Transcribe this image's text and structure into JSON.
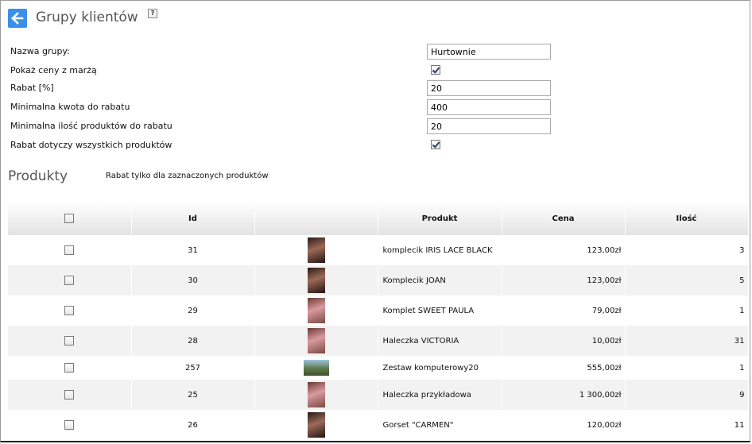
{
  "header": {
    "title": "Grupy klientów",
    "help": "?"
  },
  "form": {
    "group_name_label": "Nazwa grupy:",
    "group_name_value": "Hurtownie",
    "show_prices_label": "Pokaż ceny z marżą",
    "show_prices_checked": true,
    "discount_label": "Rabat [%]",
    "discount_value": "20",
    "min_amount_label": "Minimalna kwota do rabatu",
    "min_amount_value": "400",
    "min_qty_label": "Minimalna ilość produktów do rabatu",
    "min_qty_value": "20",
    "all_products_label": "Rabat dotyczy wszystkich produktów",
    "all_products_checked": true
  },
  "products": {
    "title": "Produkty",
    "note": "Rabat tylko dla zaznaczonych produktów",
    "columns": {
      "id": "Id",
      "image": "",
      "product": "Produkt",
      "price": "Cena",
      "qty": "Ilość"
    },
    "rows": [
      {
        "id": "31",
        "name": "komplecik IRIS LACE BLACK",
        "price": "123,00zł",
        "qty": "3",
        "thumb": "dark"
      },
      {
        "id": "30",
        "name": "Komplecik JOAN",
        "price": "123,00zł",
        "qty": "5",
        "thumb": "dark"
      },
      {
        "id": "29",
        "name": "Komplet SWEET PAULA",
        "price": "79,00zł",
        "qty": "1",
        "thumb": "pink"
      },
      {
        "id": "28",
        "name": "Haleczka VICTORIA",
        "price": "10,00zł",
        "qty": "31",
        "thumb": "pink"
      },
      {
        "id": "257",
        "name": "Zestaw komputerowy20",
        "price": "555,00zł",
        "qty": "1",
        "thumb": "wide"
      },
      {
        "id": "25",
        "name": "Haleczka przykładowa",
        "price": "1 300,00zł",
        "qty": "9",
        "thumb": "pink"
      },
      {
        "id": "26",
        "name": "Gorset \"CARMEN\"",
        "price": "120,00zł",
        "qty": "11",
        "thumb": "dark"
      }
    ]
  },
  "colors": {
    "accent": "#3b8fe8",
    "header_gradient_end": "#e3e3e3",
    "row_alt": "#f2f2f2"
  },
  "icons": {
    "back": "arrow-left-icon",
    "help": "help-icon"
  }
}
